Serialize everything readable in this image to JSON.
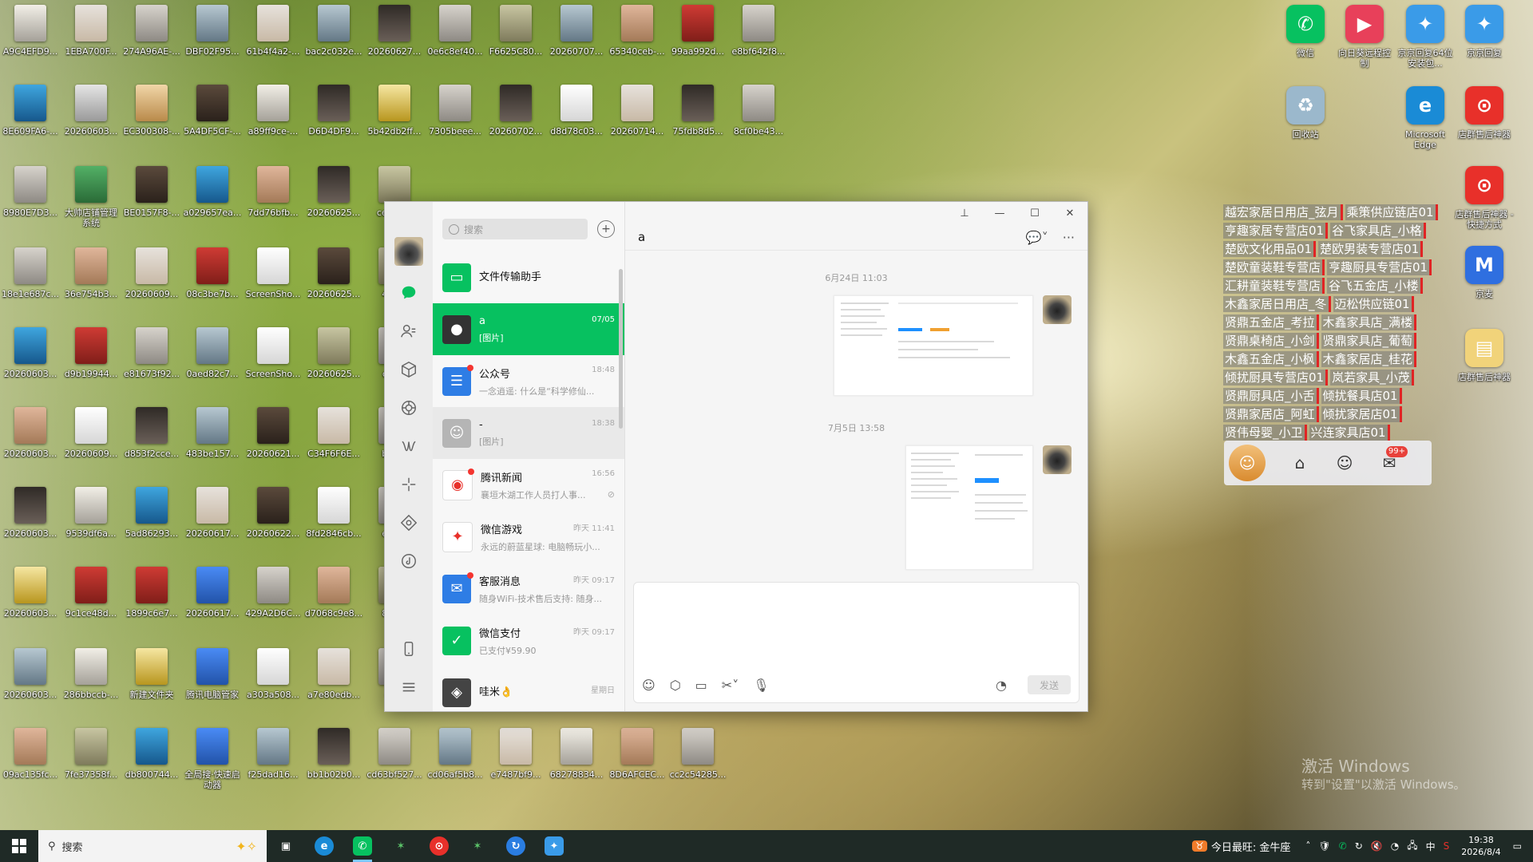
{
  "desktop": {
    "icons": [
      {
        "label": "A9C4EFD9...",
        "c": "t1"
      },
      {
        "label": "1EBA700F...",
        "c": "t3"
      },
      {
        "label": "274A96AE-...",
        "c": "t0"
      },
      {
        "label": "DBF02F95...",
        "c": "t4"
      },
      {
        "label": "61b4f4a2-...",
        "c": "t3"
      },
      {
        "label": "bac2c032e...",
        "c": "t4"
      },
      {
        "label": "20260627...",
        "c": "t2"
      },
      {
        "label": "0e6c8ef40...",
        "c": "t0"
      },
      {
        "label": "F6625C80...",
        "c": "t5"
      },
      {
        "label": "20260707...",
        "c": "t4"
      },
      {
        "label": "65340ceb-...",
        "c": "t8"
      },
      {
        "label": "99aa992d...",
        "c": "tb"
      },
      {
        "label": "e8bf642f8...",
        "c": "t0"
      },
      {
        "label": "8E609FA6-...",
        "c": "tc"
      },
      {
        "label": "20260603...",
        "c": "ta"
      },
      {
        "label": "EC300308-...",
        "c": "te"
      },
      {
        "label": "5A4DF5CF-...",
        "c": "t7"
      },
      {
        "label": "a89ff9ce-...",
        "c": "t1"
      },
      {
        "label": "D6D4DF9...",
        "c": "t2"
      },
      {
        "label": "5b42db2ff...",
        "c": "t9"
      },
      {
        "label": "7305beee...",
        "c": "t0"
      },
      {
        "label": "20260702...",
        "c": "t2"
      },
      {
        "label": "d8d78c03...",
        "c": "t6"
      },
      {
        "label": "20260714...",
        "c": "t3"
      },
      {
        "label": "75fdb8d5...",
        "c": "t2"
      },
      {
        "label": "8cf0be43...",
        "c": "t0"
      },
      {
        "label": "8980E7D3...",
        "c": "t0"
      },
      {
        "label": "大帅店铺管理系统",
        "c": "td"
      },
      {
        "label": "BE0157F8-...",
        "c": "t7"
      },
      {
        "label": "a029657ea...",
        "c": "tc"
      },
      {
        "label": "7dd76bfb...",
        "c": "t8"
      },
      {
        "label": "20260625...",
        "c": "t2"
      },
      {
        "label": "ce300...",
        "c": "t5"
      },
      {
        "label": "18e1e687c...",
        "c": "t0"
      },
      {
        "label": "36e754b3...",
        "c": "t8"
      },
      {
        "label": "20260609...",
        "c": "t3"
      },
      {
        "label": "08c3be7b...",
        "c": "tb"
      },
      {
        "label": "ScreenSho...",
        "c": "t6"
      },
      {
        "label": "20260625...",
        "c": "t7"
      },
      {
        "label": "4e8...",
        "c": "t5"
      },
      {
        "label": "20260603...",
        "c": "tc"
      },
      {
        "label": "d9b19944...",
        "c": "tb"
      },
      {
        "label": "e81673f92...",
        "c": "t0"
      },
      {
        "label": "0aed82c7...",
        "c": "t4"
      },
      {
        "label": "ScreenSho...",
        "c": "t6"
      },
      {
        "label": "20260625...",
        "c": "t5"
      },
      {
        "label": "ce3...",
        "c": "t0"
      },
      {
        "label": "20260603...",
        "c": "t8"
      },
      {
        "label": "20260609...",
        "c": "t6"
      },
      {
        "label": "d853f2cce...",
        "c": "t2"
      },
      {
        "label": "483be157...",
        "c": "t4"
      },
      {
        "label": "20260621...",
        "c": "t7"
      },
      {
        "label": "C34F6F6E...",
        "c": "t3"
      },
      {
        "label": "bd7...",
        "c": "t0"
      },
      {
        "label": "20260603...",
        "c": "t2"
      },
      {
        "label": "9539df6a...",
        "c": "t1"
      },
      {
        "label": "5ad86293...",
        "c": "tc"
      },
      {
        "label": "20260617...",
        "c": "t3"
      },
      {
        "label": "20260622...",
        "c": "t7"
      },
      {
        "label": "8fd2846cb...",
        "c": "t6"
      },
      {
        "label": "e75...",
        "c": "t0"
      },
      {
        "label": "20260603...",
        "c": "t9"
      },
      {
        "label": "9c1ce48d...",
        "c": "tb"
      },
      {
        "label": "1899c6e7...",
        "c": "tb"
      },
      {
        "label": "20260617...",
        "c": "tf"
      },
      {
        "label": "429A2D6C...",
        "c": "t0"
      },
      {
        "label": "d7068c9e8...",
        "c": "t8"
      },
      {
        "label": "857...",
        "c": "t5"
      },
      {
        "label": "20260603...",
        "c": "t4"
      },
      {
        "label": "286bbccb-...",
        "c": "t1"
      },
      {
        "label": "新建文件夹",
        "c": "t9"
      },
      {
        "label": "腾讯电脑管家",
        "c": "tf"
      },
      {
        "label": "a303a508...",
        "c": "t6"
      },
      {
        "label": "a7e80edb...",
        "c": "t3"
      },
      {
        "label": "e3...",
        "c": "t0"
      },
      {
        "label": "09ac135fc...",
        "c": "t8"
      },
      {
        "label": "7fe37358f...",
        "c": "t5"
      },
      {
        "label": "db800744...",
        "c": "tc"
      },
      {
        "label": "全局搜·快速启动器",
        "c": "tf"
      },
      {
        "label": "f25dad16...",
        "c": "t4"
      },
      {
        "label": "bb1b02b0...",
        "c": "t2"
      },
      {
        "label": "cd63bf527...",
        "c": "t0"
      },
      {
        "label": "cd06af5b8...",
        "c": "t4"
      },
      {
        "label": "e7487bf9...",
        "c": "t3"
      },
      {
        "label": "68278834...",
        "c": "t1"
      },
      {
        "label": "8D6AFCEC...",
        "c": "t8"
      },
      {
        "label": "cc2c54285...",
        "c": "t0"
      }
    ],
    "apps": [
      {
        "label": "微信",
        "glyph": "✆",
        "color": "#07c160"
      },
      {
        "label": "向日葵远程控制",
        "glyph": "▶",
        "color": "#e8405a"
      },
      {
        "label": "京京回复64位安装包...",
        "glyph": "✦",
        "color": "#3a9be8"
      },
      {
        "label": "京京回复",
        "glyph": "✦",
        "color": "#3a9be8"
      },
      {
        "label": "回收站",
        "glyph": "♻",
        "color": "#9bb8cc"
      },
      {
        "label": "Microsoft Edge",
        "glyph": "e",
        "color": "#1a8bd6"
      },
      {
        "label": "店群售后神器",
        "glyph": "⊙",
        "color": "#e8302a"
      },
      {
        "label": "店群售后神器 - 快捷方式",
        "glyph": "⊙",
        "color": "#e8302a"
      },
      {
        "label": "京麦",
        "glyph": "M",
        "color": "#2f6fe0"
      },
      {
        "label": "店群售后神器",
        "glyph": "▤",
        "color": "#f1d37a"
      }
    ],
    "stores": [
      [
        "越宏家居日用店_弦月",
        "乘策供应链店01"
      ],
      [
        "亨趣家居专营店01",
        "谷飞家具店_小格"
      ],
      [
        "楚欧文化用品01",
        "楚欧男装专营店01"
      ],
      [
        "楚欧童装鞋专营店",
        "亨趣厨具专营店01"
      ],
      [
        "汇耕童装鞋专营店",
        "谷飞五金店_小楼"
      ],
      [
        "木鑫家居日用店_冬",
        "迈松供应链01"
      ],
      [
        "贤鼎五金店_考拉",
        "木鑫家具店_满楼"
      ],
      [
        "贤鼎桌椅店_小剑",
        "贤鼎家具店_葡萄"
      ],
      [
        "木鑫五金店_小枫",
        "木鑫家居店_桂花"
      ],
      [
        "倾扰厨具专营店01",
        "岚若家具_小茂"
      ],
      [
        "贤鼎厨具店_小舌",
        "倾扰餐具店01"
      ],
      [
        "贤鼎家居店_阿虹",
        "倾扰家居店01"
      ],
      [
        "贤伟母婴_小卫",
        "兴连家具店01"
      ]
    ],
    "store_bar_badge": "99+",
    "watermark_title": "激活 Windows",
    "watermark_sub": "转到\"设置\"以激活 Windows。"
  },
  "wechat": {
    "search_placeholder": "搜索",
    "chat_title": "a",
    "conversations": [
      {
        "name": "文件传输助手",
        "time": "",
        "preview": "",
        "color": "#07c160",
        "glyph": "▭",
        "state": "",
        "dot": false,
        "mute": false
      },
      {
        "name": "a",
        "time": "07/05",
        "preview": "[图片]",
        "color": "#333",
        "glyph": "●",
        "state": "active",
        "dot": false,
        "mute": false
      },
      {
        "name": "公众号",
        "time": "18:48",
        "preview": "一念逍遥: 什么是“科学修仙...",
        "color": "#2e7de5",
        "glyph": "☰",
        "state": "",
        "dot": true,
        "mute": false
      },
      {
        "name": "-",
        "time": "18:38",
        "preview": "[图片]",
        "color": "#b5b5b5",
        "glyph": "☺",
        "state": "grey",
        "dot": false,
        "mute": false
      },
      {
        "name": "腾讯新闻",
        "time": "16:56",
        "preview": "襄垣木湖工作人员打人事...",
        "color": "#fff",
        "glyph": "◉",
        "state": "",
        "dot": true,
        "mute": true
      },
      {
        "name": "微信游戏",
        "time": "昨天 11:41",
        "preview": "永远的蔚蓝星球: 电脑畅玩小...",
        "color": "#fff",
        "glyph": "✦",
        "state": "",
        "dot": false,
        "mute": false
      },
      {
        "name": "客服消息",
        "time": "昨天 09:17",
        "preview": "随身WiFi-技术售后支持: 随身...",
        "color": "#2e7de5",
        "glyph": "✉",
        "state": "",
        "dot": true,
        "mute": false
      },
      {
        "name": "微信支付",
        "time": "昨天 09:17",
        "preview": "已支付¥59.90",
        "color": "#07c160",
        "glyph": "✓",
        "state": "",
        "dot": false,
        "mute": false
      },
      {
        "name": "哇米👌",
        "time": "星期日",
        "preview": "",
        "color": "#444",
        "glyph": "◈",
        "state": "",
        "dot": false,
        "mute": false
      }
    ],
    "timestamps": [
      "6月24日 11:03",
      "7月5日 13:58"
    ],
    "send_label": "发送"
  },
  "taskbar": {
    "search_placeholder": "搜索",
    "weather": "今日最旺: 金牛座",
    "time": "19:38",
    "date": "2026/8/4",
    "ime": "中"
  }
}
